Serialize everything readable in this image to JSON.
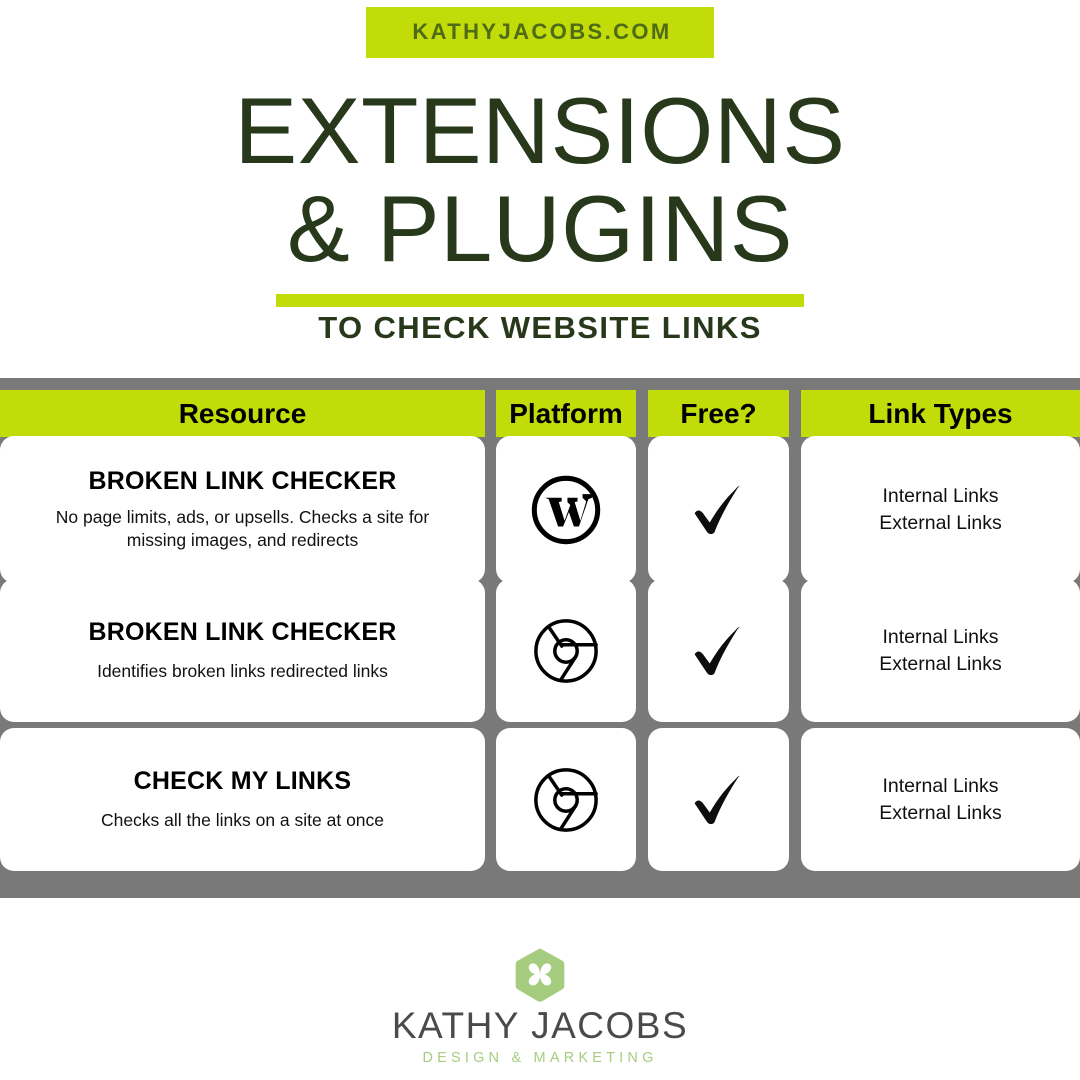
{
  "header": {
    "site_badge": "KATHYJACOBS.COM",
    "title_line_1": "EXTENSIONS",
    "title_line_2": "& PLUGINS",
    "subtitle": "TO CHECK WEBSITE LINKS"
  },
  "colors": {
    "accent_green": "#c2dc0a",
    "dark_green": "#27381b",
    "table_gray": "#797979",
    "logo_leaf_green": "#a6cd7f",
    "logo_text_gray": "#4a4a4a"
  },
  "table": {
    "columns": [
      "Resource",
      "Platform",
      "Free?",
      "Link Types"
    ],
    "rows": [
      {
        "resource_name": "BROKEN LINK CHECKER",
        "resource_desc": "No page limits, ads, or upsells. Checks a site for missing images, and redirects",
        "platform_icon": "wordpress-icon",
        "free_icon": "checkmark-icon",
        "link_types_line_1": "Internal Links",
        "link_types_line_2": "External Links"
      },
      {
        "resource_name": "BROKEN LINK CHECKER",
        "resource_desc": "Identifies broken links redirected links",
        "platform_icon": "chrome-icon",
        "free_icon": "checkmark-icon",
        "link_types_line_1": "Internal Links",
        "link_types_line_2": "External Links"
      },
      {
        "resource_name": "CHECK MY LINKS",
        "resource_desc": "Checks all the links on a site at once",
        "platform_icon": "chrome-icon",
        "free_icon": "checkmark-icon",
        "link_types_line_1": "Internal Links",
        "link_types_line_2": "External Links"
      }
    ]
  },
  "footer": {
    "logo_icon": "flower-hexagon-icon",
    "logo_name": "KATHY JACOBS",
    "logo_tagline": "DESIGN & MARKETING"
  }
}
